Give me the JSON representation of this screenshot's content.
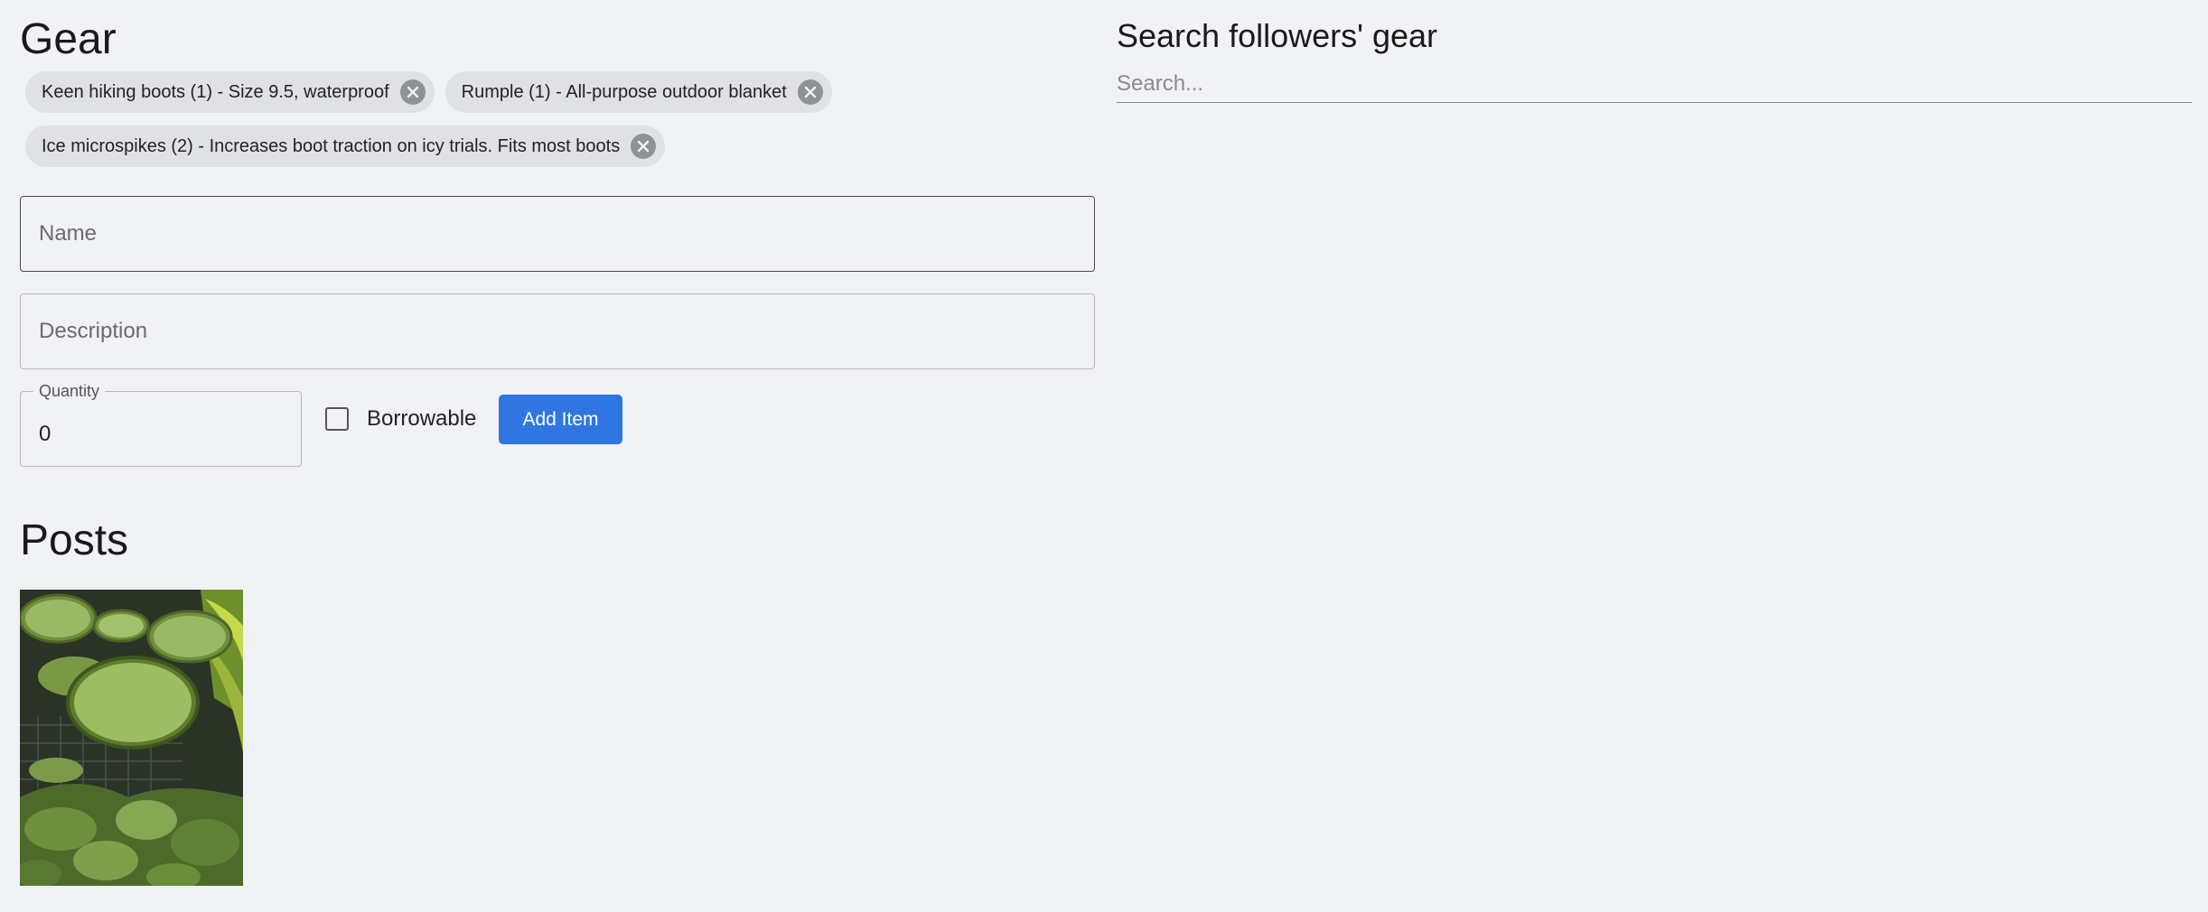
{
  "gear": {
    "title": "Gear",
    "items": [
      {
        "label": "Keen hiking boots (1) - Size 9.5, waterproof",
        "remove_icon": "close-circle-icon"
      },
      {
        "label": "Rumple (1) - All-purpose outdoor blanket",
        "remove_icon": "close-circle-icon"
      },
      {
        "label": "Ice microspikes (2) - Increases boot traction on icy trials. Fits most boots",
        "remove_icon": "close-circle-icon"
      }
    ],
    "form": {
      "name_placeholder": "Name",
      "name_value": "",
      "description_placeholder": "Description",
      "description_value": "",
      "quantity_label": "Quantity",
      "quantity_value": "0",
      "borrowable_label": "Borrowable",
      "borrowable_checked": false,
      "add_button_label": "Add Item"
    }
  },
  "posts": {
    "title": "Posts",
    "images": [
      {
        "alt": "Giant water lily pads in a greenhouse pond"
      }
    ]
  },
  "search": {
    "title": "Search followers' gear",
    "placeholder": "Search...",
    "value": ""
  },
  "colors": {
    "background": "#f0f2f6",
    "chip_background": "#dfe1e5",
    "accent": "#2f76e2"
  }
}
